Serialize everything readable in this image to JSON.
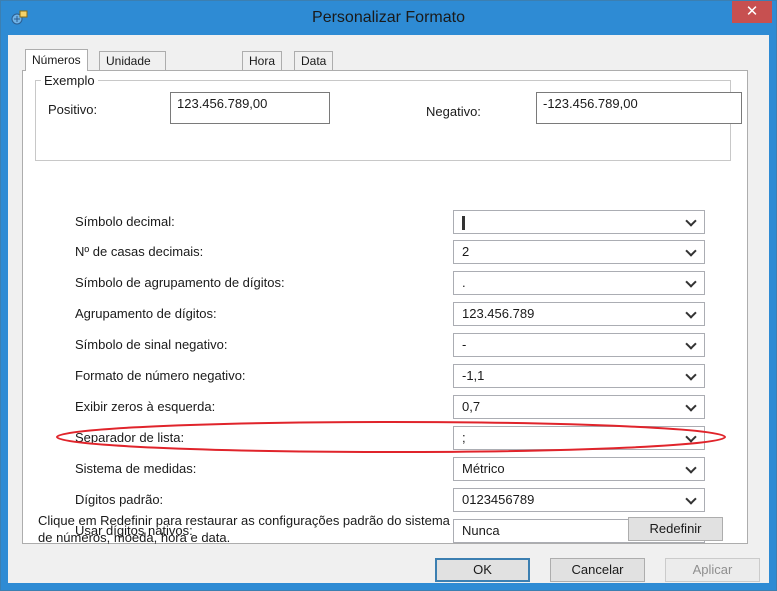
{
  "window": {
    "title": "Personalizar Formato"
  },
  "tabs": [
    "Números",
    "Unidade Monetária",
    "Hora",
    "Data"
  ],
  "example": {
    "legend": "Exemplo",
    "positive_label": "Positivo:",
    "positive_value": "123.456.789,00",
    "negative_label": "Negativo:",
    "negative_value": "-123.456.789,00"
  },
  "settings": [
    {
      "label": "Símbolo decimal:",
      "value": ""
    },
    {
      "label": "Nº de casas decimais:",
      "value": "2"
    },
    {
      "label": "Símbolo de agrupamento de dígitos:",
      "value": "."
    },
    {
      "label": "Agrupamento de dígitos:",
      "value": "123.456.789"
    },
    {
      "label": "Símbolo de sinal negativo:",
      "value": "-"
    },
    {
      "label": "Formato de número negativo:",
      "value": "-1,1"
    },
    {
      "label": "Exibir zeros à esquerda:",
      "value": "0,7"
    },
    {
      "label": "Separador de lista:",
      "value": ";"
    },
    {
      "label": "Sistema de medidas:",
      "value": "Métrico"
    },
    {
      "label": "Dígitos padrão:",
      "value": "0123456789"
    },
    {
      "label": "Usar dígitos nativos:",
      "value": "Nunca"
    }
  ],
  "info": {
    "line1": "Clique em Redefinir para restaurar as configurações padrão do sistema",
    "line2": "de números, moeda, hora e data."
  },
  "buttons": {
    "reset": "Redefinir",
    "ok": "OK",
    "cancel": "Cancelar",
    "apply": "Aplicar"
  },
  "close_glyph": "✕",
  "colors": {
    "titlebar": "#2e8bd4",
    "close": "#c75050",
    "highlight": "#e0242b"
  }
}
